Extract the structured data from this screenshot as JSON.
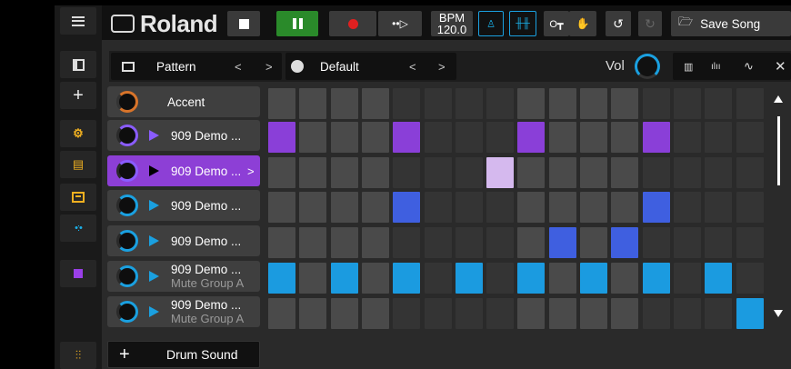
{
  "toolbar": {
    "logo": "Roland",
    "bpm_label": "BPM",
    "bpm_value": "120.0",
    "save_song": "Save Song"
  },
  "control_bar": {
    "pattern_label": "Pattern",
    "kit_label": "Default",
    "vol_label": "Vol",
    "prev": "<",
    "next": ">",
    "close": "✕"
  },
  "tracks": [
    {
      "name": "Accent",
      "sub": ""
    },
    {
      "name": "909 Demo ...",
      "sub": ""
    },
    {
      "name": "909 Demo ...",
      "sub": "",
      "selected": true,
      "arrow": ">"
    },
    {
      "name": "909 Demo ...",
      "sub": ""
    },
    {
      "name": "909 Demo ...",
      "sub": ""
    },
    {
      "name": "909 Demo ...",
      "sub": "Mute Group A"
    },
    {
      "name": "909 Demo ...",
      "sub": "Mute Group A"
    }
  ],
  "add_drum_sound": "Drum Sound",
  "add_symbol": "+",
  "steps": [
    [
      0,
      0,
      0,
      0,
      0,
      0,
      0,
      0,
      0,
      0,
      0,
      0,
      0,
      0,
      0,
      0
    ],
    [
      1,
      0,
      0,
      0,
      1,
      0,
      0,
      0,
      1,
      0,
      0,
      0,
      1,
      0,
      0,
      0
    ],
    [
      0,
      0,
      0,
      0,
      0,
      0,
      0,
      2,
      0,
      0,
      0,
      0,
      0,
      0,
      0,
      0
    ],
    [
      0,
      0,
      0,
      0,
      3,
      0,
      0,
      0,
      0,
      0,
      0,
      0,
      3,
      0,
      0,
      0
    ],
    [
      0,
      0,
      0,
      0,
      0,
      0,
      0,
      0,
      0,
      3,
      0,
      3,
      0,
      0,
      0,
      0
    ],
    [
      4,
      0,
      4,
      0,
      4,
      0,
      4,
      0,
      4,
      0,
      4,
      0,
      4,
      0,
      4,
      0
    ],
    [
      0,
      0,
      0,
      0,
      0,
      0,
      0,
      0,
      0,
      0,
      0,
      0,
      0,
      0,
      0,
      4
    ]
  ],
  "colors": {
    "accent_purple": "#8d3fd6",
    "step_purple": "#8a3fd8",
    "step_lavender": "#d5b9ee",
    "step_blue": "#3f5fe0",
    "step_cyan": "#1b9be0",
    "play_green": "#2a8a2a",
    "record_red": "#e02020",
    "step_light": "#4a4a4a",
    "step_dark": "#343434"
  }
}
